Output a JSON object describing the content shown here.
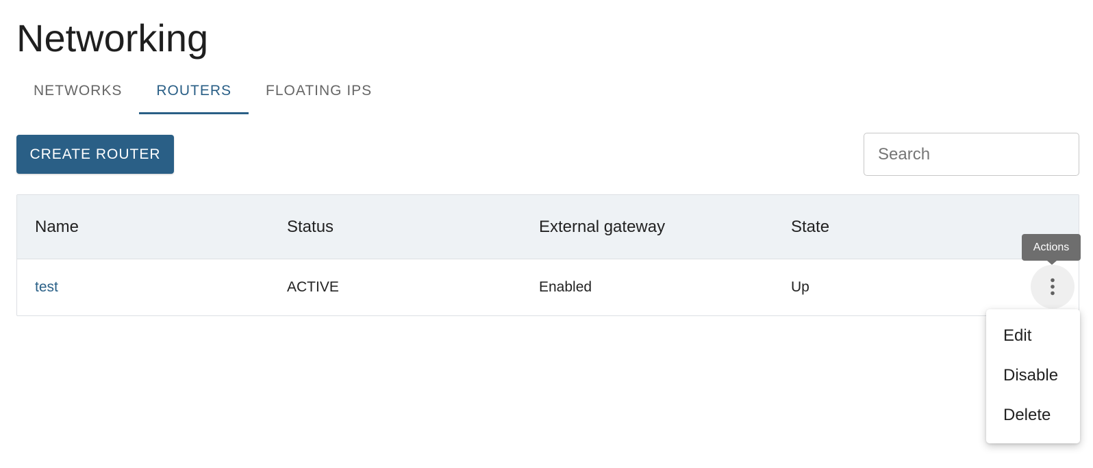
{
  "page": {
    "title": "Networking"
  },
  "tabs": [
    {
      "label": "NETWORKS",
      "active": false
    },
    {
      "label": "ROUTERS",
      "active": true
    },
    {
      "label": "FLOATING IPS",
      "active": false
    }
  ],
  "toolbar": {
    "create_label": "CREATE ROUTER",
    "search_placeholder": "Search",
    "search_value": ""
  },
  "table": {
    "columns": [
      "Name",
      "Status",
      "External gateway",
      "State"
    ],
    "rows": [
      {
        "name": "test",
        "status": "ACTIVE",
        "external_gateway": "Enabled",
        "state": "Up"
      }
    ]
  },
  "actions": {
    "tooltip": "Actions",
    "icon": "more-vert-icon",
    "menu": [
      "Edit",
      "Disable",
      "Delete"
    ]
  },
  "colors": {
    "primary": "#2a5f86",
    "header_bg": "#eef2f5",
    "tooltip_bg": "#6e6e6e"
  }
}
